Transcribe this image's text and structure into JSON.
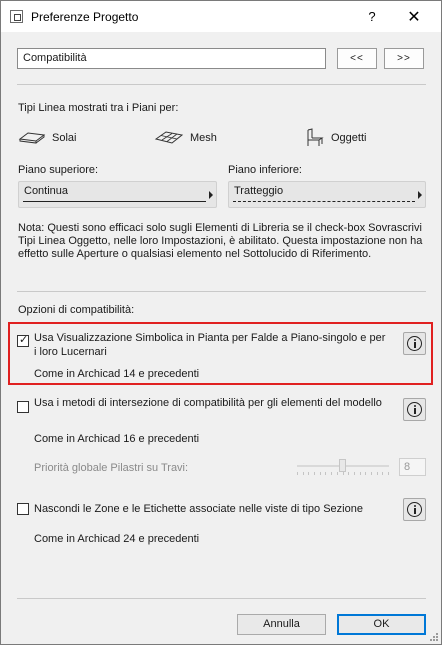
{
  "window": {
    "title": "Preferenze Progetto",
    "help_symbol": "?",
    "close_symbol": "✕"
  },
  "header": {
    "dropdown_value": "Compatibilità",
    "prev_label": "<<",
    "next_label": ">>"
  },
  "linetypes": {
    "heading": "Tipi Linea mostrati tra i Piani per:",
    "options": [
      {
        "label": "Solai",
        "icon": "slab-icon"
      },
      {
        "label": "Mesh",
        "icon": "mesh-icon"
      },
      {
        "label": "Oggetti",
        "icon": "chair-icon"
      }
    ],
    "upper_label": "Piano superiore:",
    "upper_value": "Continua",
    "lower_label": "Piano inferiore:",
    "lower_value": "Tratteggio",
    "note": "Nota: Questi sono efficaci solo sugli Elementi di Libreria se il check-box Sovrascrivi Tipi Linea Oggetto, nelle loro Impostazioni, è abilitato. Questa impostazione non ha effetto sulle Aperture o qualsiasi elemento nel Sottolucido di Riferimento."
  },
  "compat": {
    "heading": "Opzioni di compatibilità:",
    "options": [
      {
        "label": "Usa Visualizzazione Simbolica in Pianta per Falde a Piano-singolo e per i loro Lucernari",
        "checked": true,
        "sub": "Come in Archicad 14 e precedenti"
      },
      {
        "label": "Usa i metodi di intersezione di compatibilità per gli elementi del modello",
        "checked": false,
        "sub": "Come in Archicad 16 e precedenti"
      },
      {
        "label": "Nascondi le Zone e le Etichette associate nelle viste di tipo Sezione",
        "checked": false,
        "sub": "Come in Archicad 24 e precedenti"
      }
    ],
    "priority_label": "Priorità globale Pilastri su Travi:",
    "priority_value": "8",
    "priority_level": 0.5,
    "check_symbol": "✓"
  },
  "footer": {
    "cancel_label": "Annulla",
    "ok_label": "OK"
  },
  "colors": {
    "highlight": "#e02020",
    "default_button": "#0078d7"
  }
}
